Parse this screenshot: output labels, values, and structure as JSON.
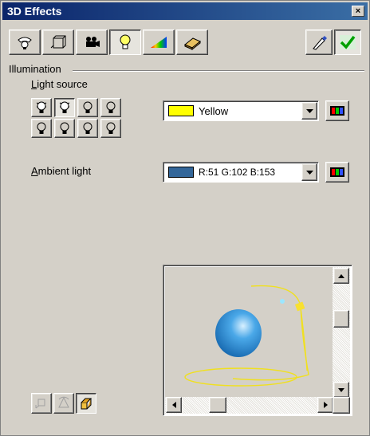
{
  "window": {
    "title": "3D Effects",
    "close_glyph": "×"
  },
  "toolbar": {
    "tabs": [
      {
        "icon": "geometry-icon",
        "pressed": false
      },
      {
        "icon": "shading-icon",
        "pressed": false
      },
      {
        "icon": "camera-icon",
        "pressed": false
      },
      {
        "icon": "lightbulb-icon",
        "pressed": true
      },
      {
        "icon": "textures-icon",
        "pressed": false
      },
      {
        "icon": "material-icon",
        "pressed": false
      }
    ],
    "right": [
      {
        "icon": "pipette-icon"
      },
      {
        "icon": "assign-check-icon"
      }
    ]
  },
  "illumination": {
    "group_label": "Illumination",
    "light_source_label": "Light source",
    "light_source_accesskey": "L",
    "light_source_rest": "ight source",
    "light_source_color": {
      "name": "Yellow",
      "hex": "#ffff00"
    },
    "ambient_label": "Ambient light",
    "ambient_accesskey": "A",
    "ambient_rest": "mbient light",
    "ambient_color": {
      "name": "R:51  G:102  B:153",
      "hex": "#336699"
    },
    "lights_selected_index": 1
  },
  "colors": {
    "face": "#d4d0c8",
    "title_start": "#0a246a",
    "title_end": "#3a6ea5",
    "sphere": "#3a9ad9",
    "light_path": "#f0e020"
  }
}
